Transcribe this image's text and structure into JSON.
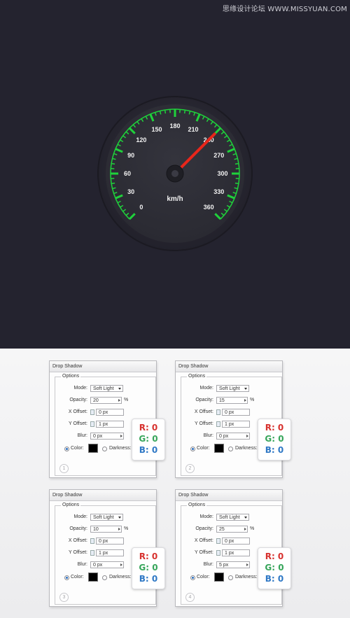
{
  "watermark": "思缘设计论坛 WWW.MISSYUAN.COM",
  "gauge": {
    "unit": "km/h",
    "ticks": [
      "0",
      "30",
      "60",
      "90",
      "120",
      "150",
      "180",
      "210",
      "240",
      "270",
      "300",
      "330",
      "360"
    ],
    "needle_value": 240,
    "colors": {
      "background": "#24232f",
      "dial_face": "#2c2c35",
      "tick_color": "#1fd23b",
      "needle": "#e8261b",
      "label": "#f2f2f2"
    }
  },
  "dialogs": [
    {
      "title": "Drop Shadow",
      "options_label": "Options",
      "mode_label": "Mode:",
      "mode_value": "Soft Light",
      "opacity_label": "Opacity:",
      "opacity_value": "20",
      "opacity_unit": "%",
      "xoffset_label": "X Offset:",
      "xoffset_value": "0 px",
      "yoffset_label": "Y Offset:",
      "yoffset_value": "1 px",
      "blur_label": "Blur:",
      "blur_value": "0 px",
      "color_label": "Color:",
      "darkness_label": "Darkness:",
      "number": "1",
      "rgb": {
        "r": "R: 0",
        "g": "G: 0",
        "b": "B: 0"
      }
    },
    {
      "title": "Drop Shadow",
      "options_label": "Options",
      "mode_label": "Mode:",
      "mode_value": "Soft Light",
      "opacity_label": "Opacity:",
      "opacity_value": "15",
      "opacity_unit": "%",
      "xoffset_label": "X Offset:",
      "xoffset_value": "0 px",
      "yoffset_label": "Y Offset:",
      "yoffset_value": "1 px",
      "blur_label": "Blur:",
      "blur_value": "0 px",
      "color_label": "Color:",
      "darkness_label": "Darkness:",
      "number": "2",
      "rgb": {
        "r": "R: 0",
        "g": "G: 0",
        "b": "B: 0"
      }
    },
    {
      "title": "Drop Shadow",
      "options_label": "Options",
      "mode_label": "Mode:",
      "mode_value": "Soft Light",
      "opacity_label": "Opacity:",
      "opacity_value": "10",
      "opacity_unit": "%",
      "xoffset_label": "X Offset:",
      "xoffset_value": "0 px",
      "yoffset_label": "Y Offset:",
      "yoffset_value": "1 px",
      "blur_label": "Blur:",
      "blur_value": "0 px",
      "color_label": "Color:",
      "darkness_label": "Darkness:",
      "number": "3",
      "rgb": {
        "r": "R: 0",
        "g": "G: 0",
        "b": "B: 0"
      }
    },
    {
      "title": "Drop Shadow",
      "options_label": "Options",
      "mode_label": "Mode:",
      "mode_value": "Soft Light",
      "opacity_label": "Opacity:",
      "opacity_value": "25",
      "opacity_unit": "%",
      "xoffset_label": "X Offset:",
      "xoffset_value": "0 px",
      "yoffset_label": "Y Offset:",
      "yoffset_value": "1 px",
      "blur_label": "Blur:",
      "blur_value": "5 px",
      "color_label": "Color:",
      "darkness_label": "Darkness:",
      "number": "4",
      "rgb": {
        "r": "R: 0",
        "g": "G: 0",
        "b": "B: 0"
      }
    }
  ],
  "rgb_colors": {
    "r": "#d7312e",
    "g": "#36a55a",
    "b": "#2f78c5"
  }
}
